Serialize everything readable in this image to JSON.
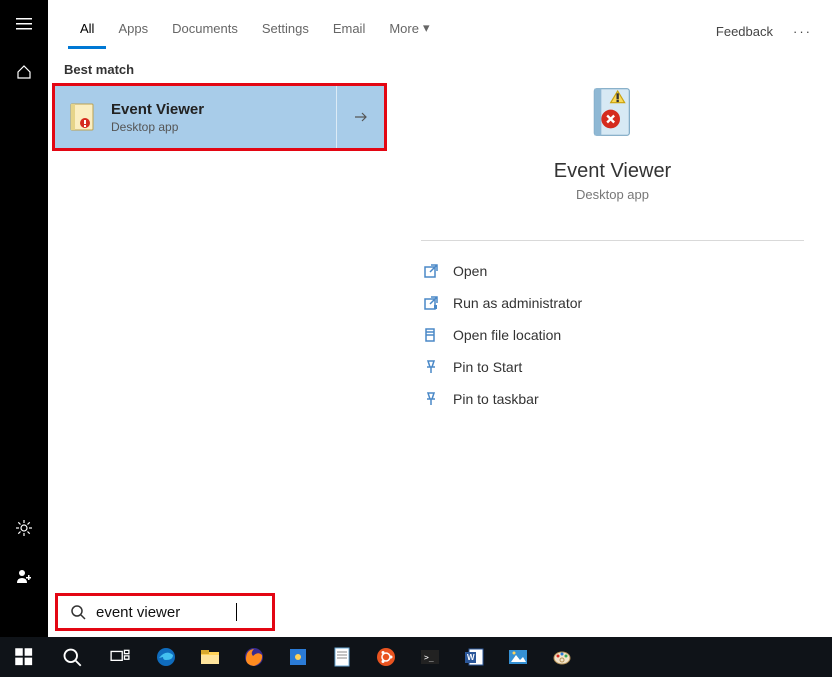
{
  "sidebar": {
    "items": [
      "menu",
      "home",
      "settings-gear",
      "account"
    ]
  },
  "tabs": {
    "items": [
      {
        "label": "All",
        "active": true
      },
      {
        "label": "Apps",
        "active": false
      },
      {
        "label": "Documents",
        "active": false
      },
      {
        "label": "Settings",
        "active": false
      },
      {
        "label": "Email",
        "active": false
      },
      {
        "label": "More",
        "active": false
      }
    ],
    "feedback_label": "Feedback"
  },
  "results": {
    "best_match_label": "Best match",
    "item": {
      "title": "Event Viewer",
      "subtitle": "Desktop app"
    }
  },
  "detail": {
    "title": "Event Viewer",
    "subtitle": "Desktop app",
    "actions": [
      {
        "icon": "open",
        "label": "Open"
      },
      {
        "icon": "admin",
        "label": "Run as administrator"
      },
      {
        "icon": "location",
        "label": "Open file location"
      },
      {
        "icon": "pin-start",
        "label": "Pin to Start"
      },
      {
        "icon": "pin-taskbar",
        "label": "Pin to taskbar"
      }
    ]
  },
  "search": {
    "value": "event viewer"
  },
  "taskbar": {
    "apps": [
      "start",
      "search",
      "task-view",
      "edge",
      "file-explorer",
      "firefox",
      "app-blue",
      "notepad",
      "ubuntu",
      "terminal",
      "word",
      "photos",
      "paint"
    ]
  }
}
